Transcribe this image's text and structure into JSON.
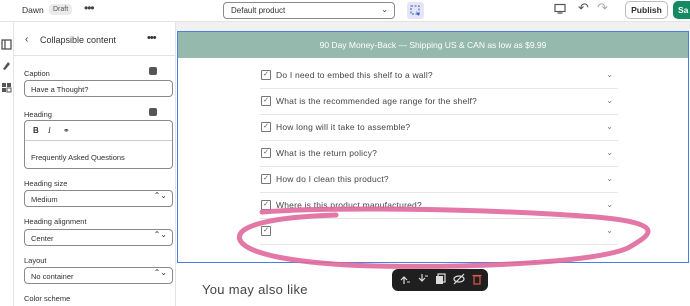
{
  "topbar": {
    "store": "Dawn",
    "badge": "Draft",
    "more": "•••",
    "template": "Default product",
    "chevron": "⌄",
    "icons": [
      "inspector-icon",
      "desktop-icon",
      "undo-icon",
      "redo-icon"
    ],
    "undo": "↶",
    "redo": "↷",
    "publish": "Publish",
    "save": "Sa"
  },
  "sidebar": {
    "back": "‹",
    "title": "Collapsible content",
    "more": "•••",
    "caption_label": "Caption",
    "caption_value": "Have a Thought?",
    "heading_label": "Heading",
    "heading_tools": {
      "bold": "B",
      "italic": "I",
      "link": "⚭"
    },
    "heading_value": "Frequently Asked Questions",
    "heading_size_label": "Heading size",
    "heading_size_value": "Medium",
    "heading_alignment_label": "Heading alignment",
    "heading_alignment_value": "Center",
    "layout_label": "Layout",
    "layout_value": "No container",
    "color_scheme_label": "Color scheme",
    "select_arrows": "⌃⌄"
  },
  "preview": {
    "banner": "90 Day Money-Back — Shipping US & CAN as low as $9.99",
    "checkmark": "✓",
    "chevron": "⌄",
    "questions": [
      "Do I need to embed this shelf to a wall?",
      "What is the recommended age range for the shelf?",
      "How long will it take to assemble?",
      "What is the return policy?",
      "How do I clean this product?",
      "Where is this product manufactured?",
      ""
    ],
    "also_like": "You may also like",
    "toolbar_icons": [
      "move-up-icon",
      "move-down-icon",
      "duplicate-icon",
      "hide-icon",
      "delete-icon"
    ]
  },
  "colors": {
    "banner": "#96b9ae",
    "selection": "#4a7fe0",
    "annotation": "#e0689b",
    "save": "#138a62"
  }
}
